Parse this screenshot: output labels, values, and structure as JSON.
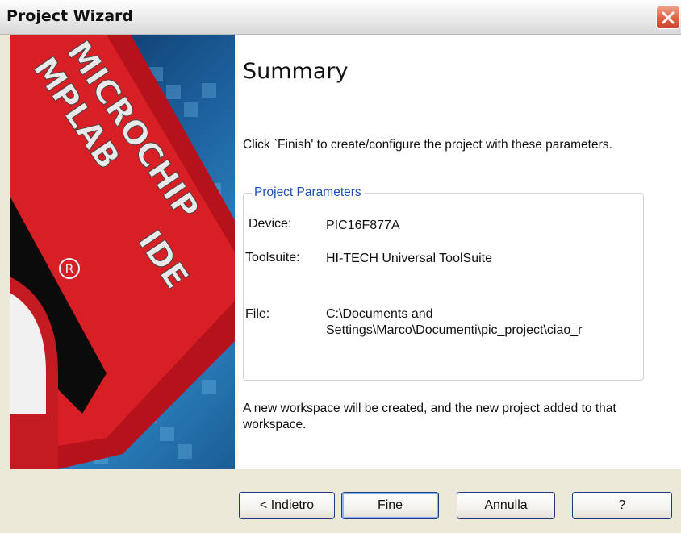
{
  "window": {
    "title": "Project Wizard"
  },
  "banner": {
    "brand": "MICROCHIP",
    "product": "MPLAB",
    "suffix": "IDE"
  },
  "page": {
    "heading": "Summary",
    "intro": "Click `Finish' to create/configure the project with these parameters.",
    "group_title": "Project Parameters",
    "params": {
      "device_label": "Device:",
      "device_value": "PIC16F877A",
      "toolsuite_label": "Toolsuite:",
      "toolsuite_value": "HI-TECH Universal ToolSuite",
      "file_label": "File:",
      "file_value_line1": "C:\\Documents and",
      "file_value_line2": "Settings\\Marco\\Documenti\\pic_project\\ciao_r"
    },
    "footer": "A new workspace will be created, and the new project added to that workspace."
  },
  "buttons": {
    "back": "< Indietro",
    "finish": "Fine",
    "cancel": "Annulla",
    "help": "?"
  },
  "colors": {
    "accent_blue": "#1f4fb8",
    "close_red": "#e06040",
    "dialog_bg": "#ece9d8"
  }
}
